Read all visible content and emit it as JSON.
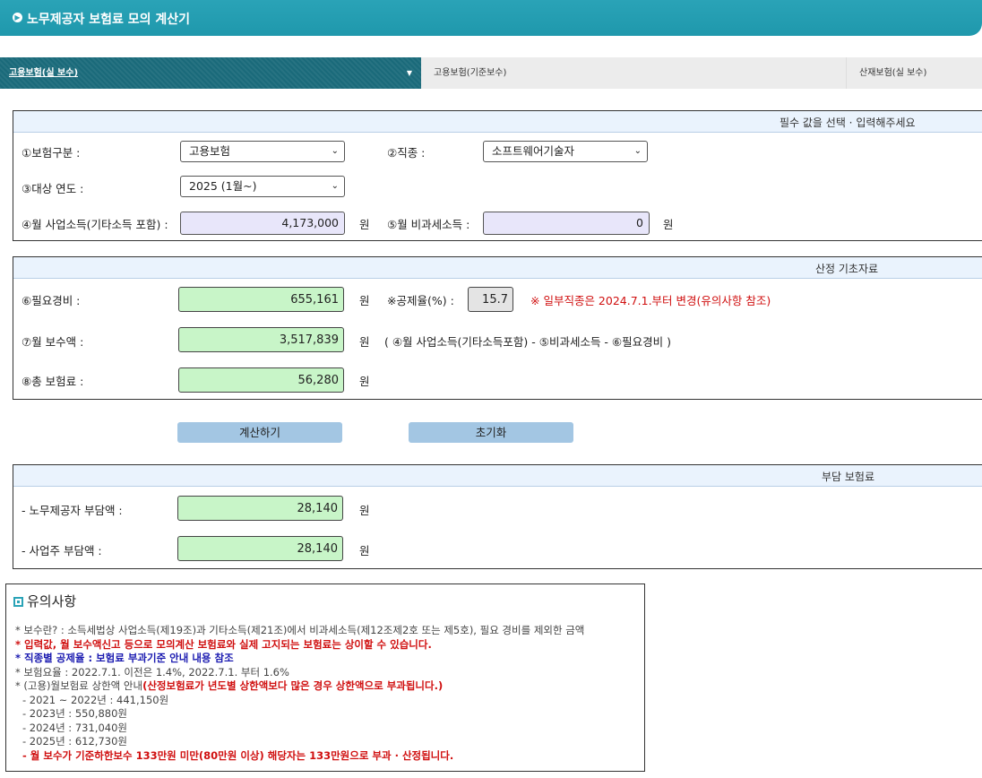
{
  "header": {
    "title": "노무제공자 보험료 모의 계산기"
  },
  "tabs": [
    {
      "label": "고용보험(실 보수)"
    },
    {
      "label": "고용보험(기준보수)"
    },
    {
      "label": "산재보험(실 보수)"
    }
  ],
  "input_section": {
    "heading": "필수 값을 선택 · 입력해주세요",
    "insurance_type_label": "①보험구분 :",
    "insurance_type_value": "고용보험",
    "occupation_label": "②직종 :",
    "occupation_value": "소프트웨어기술자",
    "year_label": "③대상 연도 :",
    "year_value": "2025 (1월~)",
    "income_label": "④월 사업소득(기타소득 포함) :",
    "income_value": "4,173,000",
    "nontax_label": "⑤월 비과세소득 :",
    "nontax_value": "0",
    "unit": "원"
  },
  "calc_section": {
    "heading": "산정 기초자료",
    "expense_label": "⑥필요경비 :",
    "expense_value": "655,161",
    "deduction_label": "※공제율(%) :",
    "deduction_value": "15.7",
    "deduction_note": "※ 일부직종은 2024.7.1.부터 변경(유의사항 참조)",
    "pay_label": "⑦월 보수액 :",
    "pay_value": "3,517,839",
    "pay_formula": "( ④월 사업소득(기타소득포함) - ⑤비과세소득 - ⑥필요경비 )",
    "total_label": "⑧총 보험료 :",
    "total_value": "56,280",
    "unit": "원"
  },
  "buttons": {
    "calc": "계산하기",
    "reset": "초기화"
  },
  "burden_section": {
    "heading": "부담 보험료",
    "worker_label": "- 노무제공자 부담액 :",
    "worker_value": "28,140",
    "employer_label": "- 사업주 부담액 :",
    "employer_value": "28,140",
    "unit": "원"
  },
  "notes": {
    "title": "유의사항",
    "line1": "* 보수란? : 소득세법상 사업소득(제19조)과 기타소득(제21조)에서 비과세소득(제12조제2호 또는 제5호), 필요 경비를 제외한 금액",
    "line2": "* 입력값, 월 보수액신고 등으로 모의계산 보험료와 실제 고지되는 보험료는 상이할 수 있습니다.",
    "line3": "* 직종별 공제율 : 보험료 부과기준 안내 내용 참조",
    "line4": "* 보험요율 : 2022.7.1. 이전은 1.4%, 2022.7.1. 부터 1.6%",
    "line5a": "* (고용)월보험료 상한액 안내",
    "line5b": "(산정보험료가 년도별 상한액보다 많은 경우 상한액으로 부과됩니다.)",
    "line6": "- 2021 ~ 2022년 : 441,150원",
    "line7": "- 2023년 : 550,880원",
    "line8": "- 2024년 : 731,040원",
    "line9": "- 2025년 : 612,730원",
    "line10": "- 월 보수가 기준하한보수 133만원 미만(80만원 이상) 해당자는 133만원으로 부과 · 산정됩니다."
  }
}
